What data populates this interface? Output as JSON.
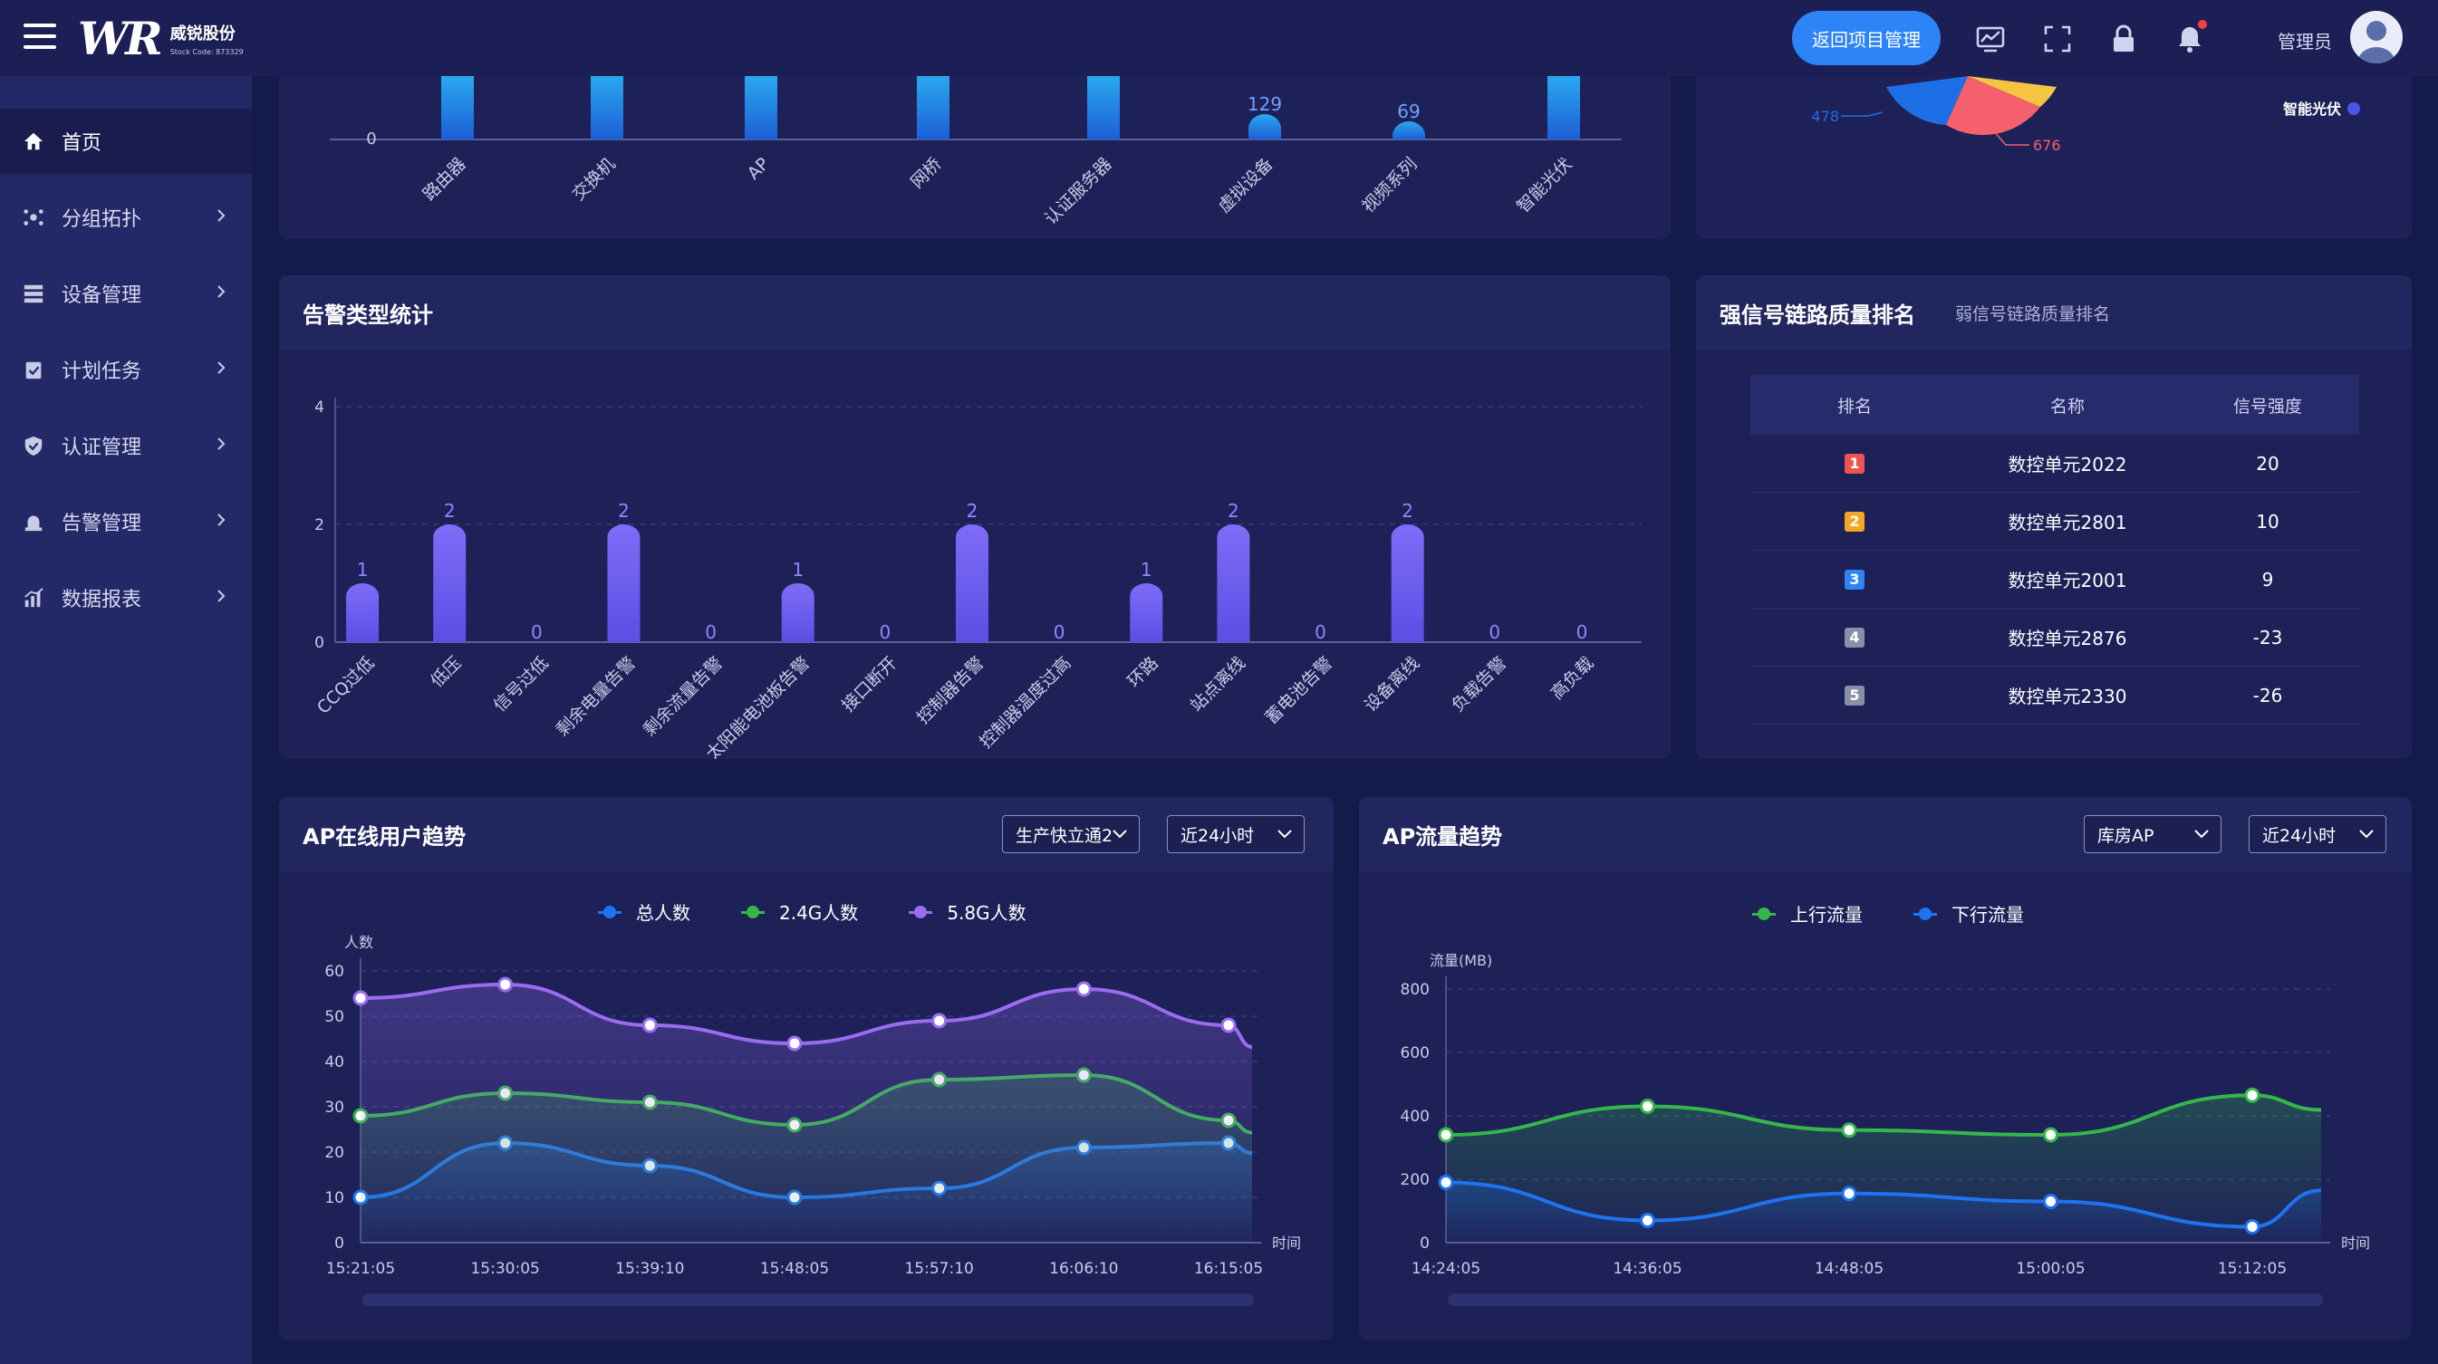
{
  "header": {
    "logo_mark": "WR",
    "company_name": "威锐股份",
    "stock_code": "Stock Code: 873329",
    "return_button": "返回项目管理",
    "user_role": "管理员"
  },
  "sidebar": {
    "items": [
      {
        "label": "首页",
        "icon": "home-icon",
        "active": true
      },
      {
        "label": "分组拓扑",
        "icon": "topology-icon"
      },
      {
        "label": "设备管理",
        "icon": "server-icon"
      },
      {
        "label": "计划任务",
        "icon": "clipboard-icon"
      },
      {
        "label": "认证管理",
        "icon": "shield-icon"
      },
      {
        "label": "告警管理",
        "icon": "alarm-icon"
      },
      {
        "label": "数据报表",
        "icon": "chart-icon"
      }
    ]
  },
  "colors": {
    "accent": "#2d84f6",
    "bar_purple": "#6a5cf2",
    "green": "#35b64a",
    "blue": "#1e73f0",
    "violet": "#9a6cf0",
    "rank1": "#ef5350",
    "rank2": "#f5a623",
    "rank3": "#2d84f6",
    "rank_other": "#8b8ea8"
  },
  "device_chart": {
    "y_tick": "0",
    "labels": [
      "路由器",
      "交换机",
      "AP",
      "网桥",
      "认证服务器",
      "虚拟设备",
      "视频系列",
      "智能光伏"
    ],
    "visible_values": [
      "",
      "",
      "",
      "",
      "",
      "129",
      "69",
      ""
    ]
  },
  "pie_card": {
    "labels": [
      "478",
      "676"
    ],
    "legend_item": "智能光伏"
  },
  "alarm_card": {
    "title": "告警类型统计",
    "chart_data": {
      "type": "bar",
      "categories": [
        "CCQ过低",
        "低压",
        "信号过低",
        "剩余电量告警",
        "剩余流量告警",
        "太阳能电池板告警",
        "接口断开",
        "控制器告警",
        "控制器温度过高",
        "环路",
        "站点离线",
        "蓄电池告警",
        "设备离线",
        "负载告警",
        "高负载"
      ],
      "values": [
        1,
        2,
        0,
        2,
        0,
        1,
        0,
        2,
        0,
        1,
        2,
        0,
        2,
        0,
        0
      ],
      "yticks": [
        "0",
        "2",
        "4"
      ],
      "ylim": [
        0,
        4
      ]
    }
  },
  "ranking": {
    "title": "强信号链路质量排名",
    "subtab": "弱信号链路质量排名",
    "columns": [
      "排名",
      "名称",
      "信号强度"
    ],
    "rows": [
      {
        "rank": "1",
        "name": "数控单元2022",
        "signal": "20"
      },
      {
        "rank": "2",
        "name": "数控单元2801",
        "signal": "10"
      },
      {
        "rank": "3",
        "name": "数控单元2001",
        "signal": "9"
      },
      {
        "rank": "4",
        "name": "数控单元2876",
        "signal": "-23"
      },
      {
        "rank": "5",
        "name": "数控单元2330",
        "signal": "-26"
      }
    ]
  },
  "ap_users": {
    "title": "AP在线用户趋势",
    "select_ap": "生产快立通2",
    "select_range": "近24小时",
    "legend": [
      "总人数",
      "2.4G人数",
      "5.8G人数"
    ],
    "ylabel": "人数",
    "xlabel": "时间",
    "chart_data": {
      "type": "line",
      "x": [
        "15:21:05",
        "15:30:05",
        "15:39:10",
        "15:48:05",
        "15:57:10",
        "16:06:10",
        "16:15:05"
      ],
      "yticks": [
        "0",
        "10",
        "20",
        "30",
        "40",
        "50",
        "60"
      ],
      "ylim": [
        0,
        60
      ],
      "series": [
        {
          "name": "总人数",
          "values": [
            10,
            22,
            17,
            10,
            12,
            21,
            22
          ]
        },
        {
          "name": "2.4G人数",
          "values": [
            28,
            33,
            31,
            26,
            36,
            37,
            27
          ]
        },
        {
          "name": "5.8G人数",
          "values": [
            54,
            57,
            48,
            44,
            49,
            56,
            48
          ]
        }
      ]
    }
  },
  "ap_traffic": {
    "title": "AP流量趋势",
    "select_ap": "库房AP",
    "select_range": "近24小时",
    "legend": [
      "上行流量",
      "下行流量"
    ],
    "ylabel": "流量(MB)",
    "xlabel": "时间",
    "chart_data": {
      "type": "line",
      "x": [
        "14:24:05",
        "14:36:05",
        "14:48:05",
        "15:00:05",
        "15:12:05"
      ],
      "yticks": [
        "0",
        "200",
        "400",
        "600",
        "800"
      ],
      "ylim": [
        0,
        800
      ],
      "series": [
        {
          "name": "上行流量",
          "values": [
            340,
            430,
            355,
            340,
            465
          ]
        },
        {
          "name": "下行流量",
          "values": [
            190,
            70,
            155,
            130,
            50
          ]
        }
      ]
    }
  }
}
